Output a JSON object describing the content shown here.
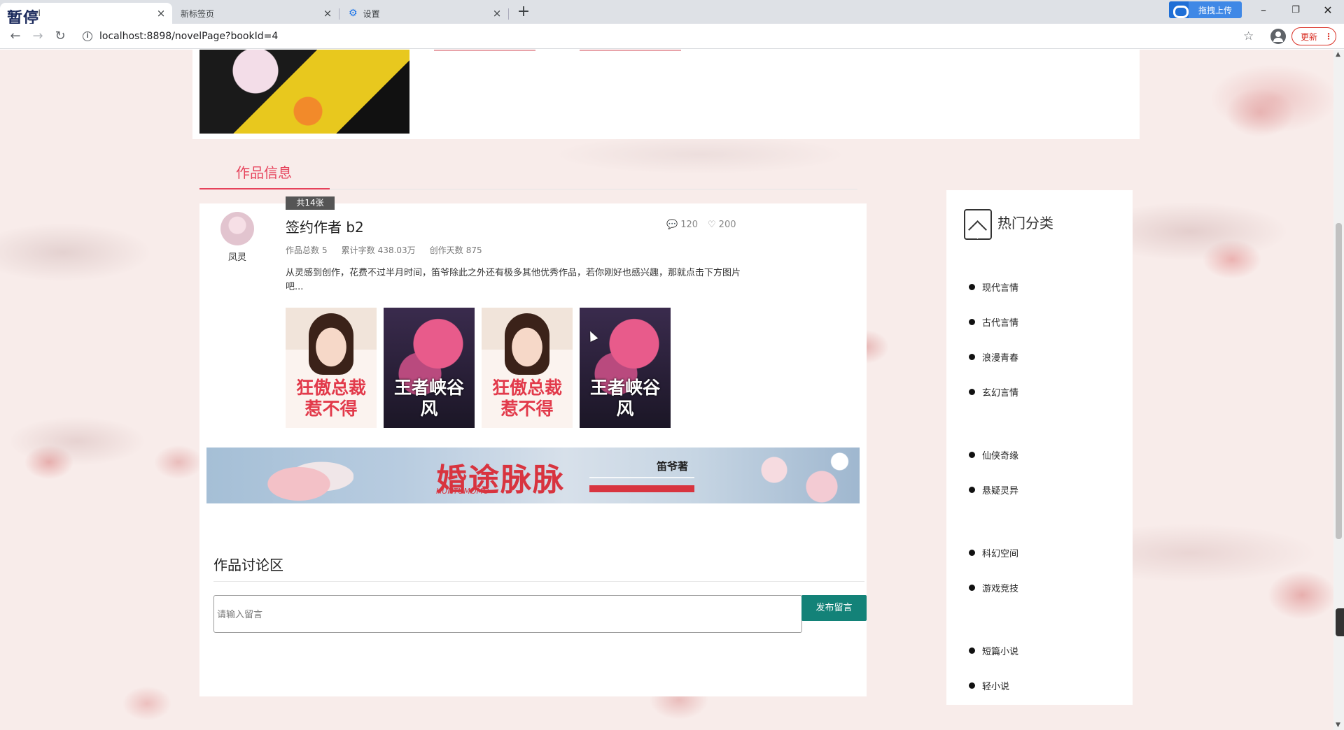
{
  "browser": {
    "paused_overlay": "暂停",
    "tabs": [
      {
        "label": "vel",
        "active": true
      },
      {
        "label": "新标签页",
        "active": false
      },
      {
        "label": "设置",
        "active": false
      }
    ],
    "upload_button": "拖拽上传",
    "url": "localhost:8898/novelPage?bookId=4",
    "update_button": "更新"
  },
  "work_tab": {
    "label": "作品信息"
  },
  "author": {
    "badge": "共14张",
    "avatar_name": "凤灵",
    "title": "签约作者 b2",
    "stats": [
      {
        "label": "作品总数",
        "value": "5"
      },
      {
        "label": "累计字数",
        "value": "438.03万"
      },
      {
        "label": "创作天数",
        "value": "875"
      }
    ],
    "comment_count": "120",
    "like_count": "200",
    "description": "从灵感到创作，花费不过半月时间，笛爷除此之外还有极多其他优秀作品，若你刚好也感兴趣，那就点击下方图片吧...",
    "books": [
      {
        "title": "狂傲总裁惹不得",
        "style": "a"
      },
      {
        "title": "王者峡谷风",
        "style": "b"
      },
      {
        "title": "狂傲总裁惹不得",
        "style": "a"
      },
      {
        "title": "王者峡谷风",
        "style": "b"
      }
    ]
  },
  "banner": {
    "title": "婚途脉脉",
    "subtitle": "HUNTUMOMO",
    "byline": "笛爷著"
  },
  "discussion": {
    "title": "作品讨论区",
    "placeholder": "请输入留言",
    "submit_label": "发布留言"
  },
  "sidebar": {
    "title": "热门分类",
    "categories": [
      "现代言情",
      "古代言情",
      "浪漫青春",
      "玄幻言情",
      "仙侠奇缘",
      "悬疑灵异",
      "科幻空间",
      "游戏竞技",
      "短篇小说",
      "轻小说"
    ]
  }
}
